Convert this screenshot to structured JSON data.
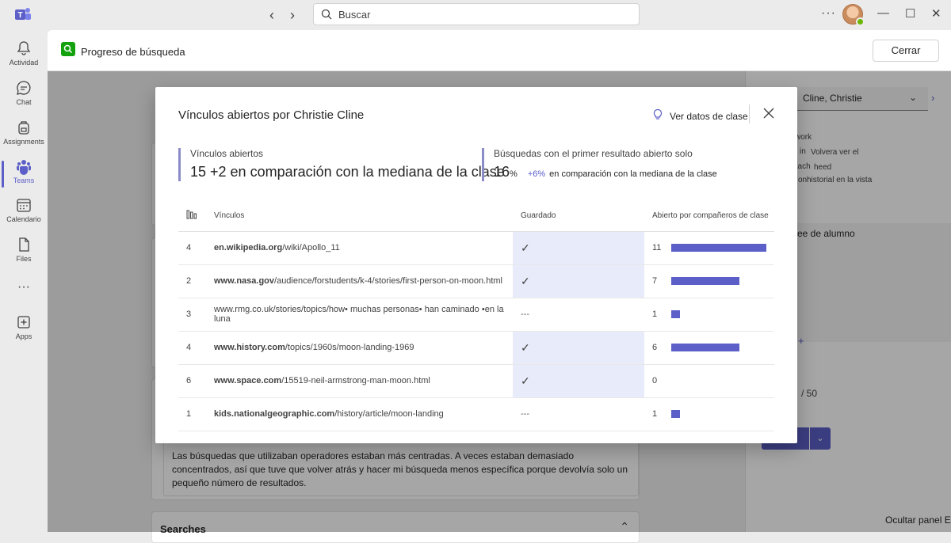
{
  "titlebar": {
    "search_placeholder": "Buscar"
  },
  "rail": {
    "items": [
      {
        "label": "Actividad",
        "icon": "bell-icon"
      },
      {
        "label": "Chat",
        "icon": "chat-icon"
      },
      {
        "label": "Assignments",
        "icon": "backpack-icon"
      },
      {
        "label": "Teams",
        "icon": "teams-icon"
      },
      {
        "label": "Calendario",
        "icon": "calendar-icon"
      },
      {
        "label": "Files",
        "icon": "file-icon"
      },
      {
        "label": "Apps",
        "icon": "apps-add-icon"
      }
    ]
  },
  "app_header": {
    "title": "Progreso de búsqueda",
    "close_label": "Cerrar"
  },
  "right_panel": {
    "student": "Cline, Christie",
    "line1": "work",
    "line2a": "in",
    "line2b": "Volvera ver el",
    "line3a": "ttach",
    "line3b": "heed",
    "line4a": "on",
    "line4b": "historial en la vista",
    "feedback_label": "ee de alumno",
    "score": "/ 50",
    "hide_panel": "Ocultar panel E"
  },
  "background": {
    "reflection_text": "Las búsquedas que utilizaban operadores estaban más centradas. A veces estaban demasiado concentrados, así que tuve que volver atrás y hacer mi búsqueda menos específica porque devolvía solo un pequeño número de resultados.",
    "searches_heading": "Searches"
  },
  "modal": {
    "title": "Vínculos abiertos por Christie Cline",
    "class_data_label": "Ver datos de clase",
    "stat_opened": {
      "label": "Vínculos abiertos",
      "value": "15 +2 en comparación con la mediana de la clase"
    },
    "stat_first": {
      "label": "Búsquedas con el primer resultado abierto solo",
      "value": "16",
      "unit": "%",
      "delta": "+6%",
      "compare": "en comparación con la mediana de la clase"
    },
    "table": {
      "headers": {
        "links": "Vínculos",
        "saved": "Guardado",
        "opened_by_peers": "Abierto por compañeros de clase"
      },
      "rows": [
        {
          "count": "4",
          "domain": "en.wikipedia.org",
          "path": "/wiki/Apollo_11",
          "saved": true,
          "opened": "11",
          "opened_fraction": 1.0
        },
        {
          "count": "2",
          "domain": "www.nasa.gov",
          "path": "/audience/forstudents/k-4/stories/first-person-on-moon.html",
          "saved": true,
          "opened": "7",
          "opened_fraction": 0.72
        },
        {
          "count": "3",
          "domain": "",
          "path": "www.rmg.co.uk/stories/topics/how• muchas personas• han caminado •en la luna",
          "saved": false,
          "opened": "1",
          "opened_fraction": 0.09
        },
        {
          "count": "4",
          "domain": "www.history.com",
          "path": "/topics/1960s/moon-landing-1969",
          "saved": true,
          "opened": "6",
          "opened_fraction": 0.72
        },
        {
          "count": "6",
          "domain": "www.space.com",
          "path": "/15519-neil-armstrong-man-moon.html",
          "saved": true,
          "opened": "0",
          "opened_fraction": 0
        },
        {
          "count": "1",
          "domain": "kids.nationalgeographic.com",
          "path": "/history/article/moon-landing",
          "saved": false,
          "opened": "1",
          "opened_fraction": 0.09
        }
      ],
      "saved_check": "✓",
      "saved_none": "---"
    }
  }
}
